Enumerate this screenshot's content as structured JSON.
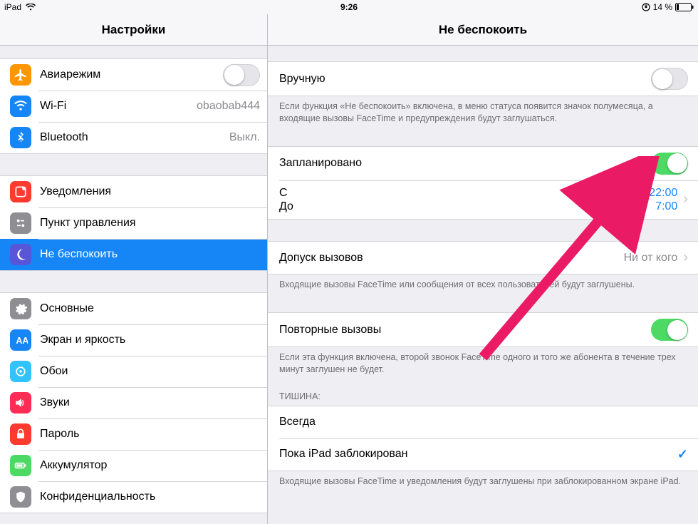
{
  "status": {
    "device": "iPad",
    "time": "9:26",
    "battery_text": "14 %"
  },
  "sidebar": {
    "title": "Настройки",
    "groups": [
      [
        {
          "key": "airplane",
          "label": "Авиарежим",
          "value": "",
          "switch": "off",
          "color": "#ff9500"
        },
        {
          "key": "wifi",
          "label": "Wi-Fi",
          "value": "obaobab444",
          "chev": false,
          "color": "#1686f7"
        },
        {
          "key": "bluetooth",
          "label": "Bluetooth",
          "value": "Выкл.",
          "chev": false,
          "color": "#1686f7"
        }
      ],
      [
        {
          "key": "notifications",
          "label": "Уведомления",
          "color": "#ff3b30"
        },
        {
          "key": "control-center",
          "label": "Пункт управления",
          "color": "#8e8e93"
        },
        {
          "key": "dnd",
          "label": "Не беспокоить",
          "selected": true,
          "color": "#5856d6"
        }
      ],
      [
        {
          "key": "general",
          "label": "Основные",
          "color": "#8e8e93"
        },
        {
          "key": "display",
          "label": "Экран и яркость",
          "color": "#1686f7"
        },
        {
          "key": "wallpaper",
          "label": "Обои",
          "color": "#32c3ff"
        },
        {
          "key": "sounds",
          "label": "Звуки",
          "color": "#ff2d55"
        },
        {
          "key": "passcode",
          "label": "Пароль",
          "color": "#ff3b30"
        },
        {
          "key": "battery",
          "label": "Аккумулятор",
          "color": "#4cd964"
        },
        {
          "key": "privacy",
          "label": "Конфиденциальность",
          "color": "#8e8e93"
        }
      ]
    ]
  },
  "detail": {
    "title": "Не беспокоить",
    "manual": {
      "label": "Вручную",
      "switch": "off"
    },
    "manual_note": "Если функция «Не беспокоить» включена, в меню статуса появится значок полумесяца, а входящие вызовы FaceTime и предупреждения будут заглушаться.",
    "scheduled": {
      "label": "Запланировано",
      "switch": "on"
    },
    "from_label": "С",
    "to_label": "До",
    "from_time": "22:00",
    "to_time": "7:00",
    "allow_calls": {
      "label": "Допуск вызовов",
      "value": "Ни от кого"
    },
    "allow_note": "Входящие вызовы FaceTime или сообщения от всех пользователей будут заглушены.",
    "repeated": {
      "label": "Повторные вызовы",
      "switch": "on"
    },
    "repeated_note": "Если эта функция включена, второй звонок FaceTime одного и того же абонента в течение трех минут заглушен не будет.",
    "silence_header": "ТИШИНА:",
    "silence_always": "Всегда",
    "silence_locked": "Пока iPad заблокирован",
    "silence_note": "Входящие вызовы FaceTime и уведомления будут заглушены при заблокированном экране iPad."
  }
}
